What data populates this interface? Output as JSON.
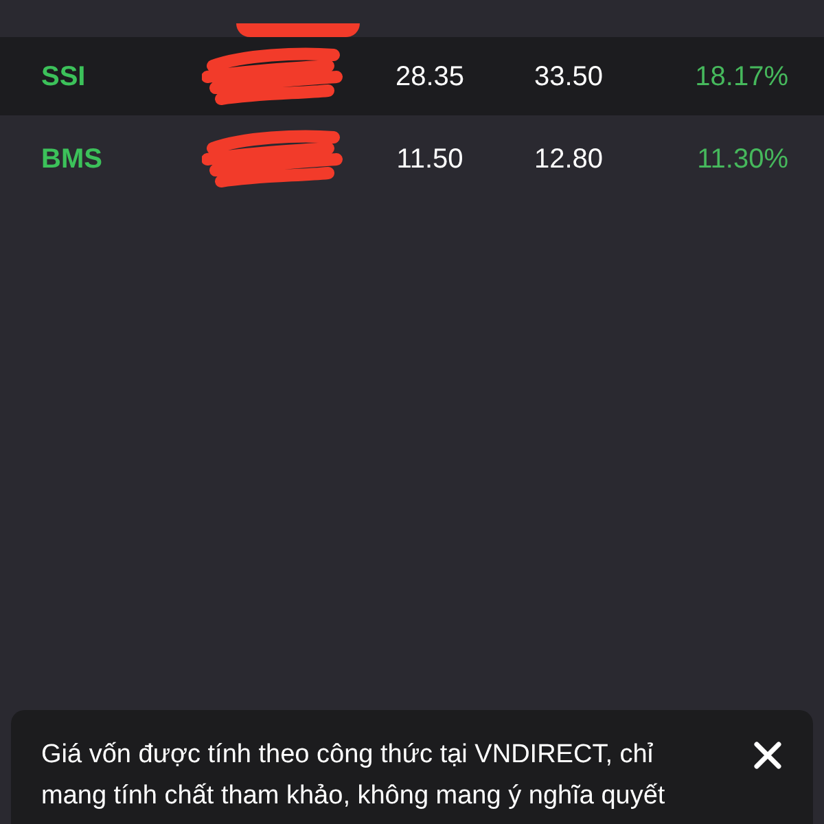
{
  "rows": [
    {
      "symbol": "SSI",
      "price_1": "28.35",
      "price_2": "33.50",
      "change": "18.17%",
      "selected": true
    },
    {
      "symbol": "BMS",
      "price_1": "11.50",
      "price_2": "12.80",
      "change": "11.30%",
      "selected": false
    }
  ],
  "notice": {
    "text": "Giá vốn được tính theo công thức tại VNDIRECT, chỉ mang tính chất tham khảo, không mang ý nghĩa quyết"
  }
}
